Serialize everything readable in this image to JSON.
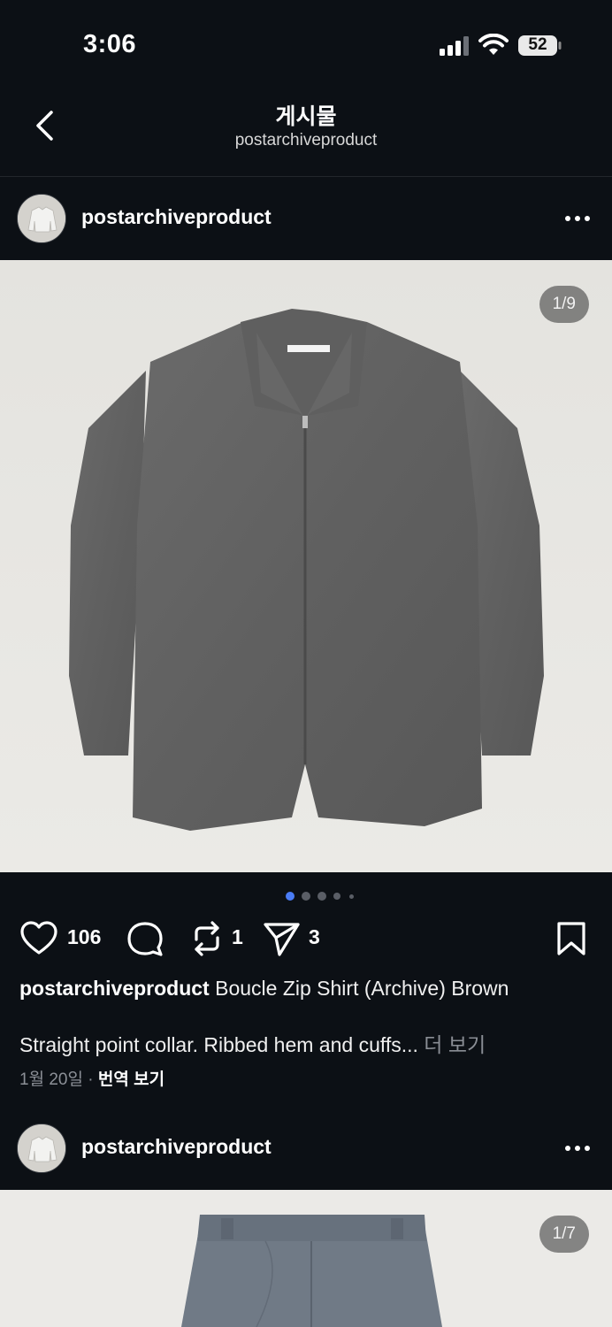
{
  "status_bar": {
    "time": "3:06",
    "battery": "52"
  },
  "nav": {
    "title": "게시물",
    "subtitle": "postarchiveproduct"
  },
  "post1": {
    "username": "postarchiveproduct",
    "image_counter": "1/9",
    "likes": "106",
    "reposts": "1",
    "shares": "3",
    "caption_title": "Boucle Zip Shirt (Archive) Brown",
    "caption_text": "Straight point collar. Ribbed hem and cuffs...",
    "more_label": "더 보기",
    "date": "1월 20일",
    "translate_label": "번역 보기"
  },
  "post2": {
    "username": "postarchiveproduct",
    "image_counter": "1/7"
  },
  "icons": {
    "back": "chevron-left-icon",
    "more": "more-dots-icon",
    "like": "heart-icon",
    "comment": "comment-icon",
    "repost": "repost-icon",
    "share": "send-icon",
    "save": "bookmark-icon"
  },
  "colors": {
    "background": "#0c1015",
    "accent_dot": "#4a7cf5",
    "muted_text": "#8a8e95"
  }
}
